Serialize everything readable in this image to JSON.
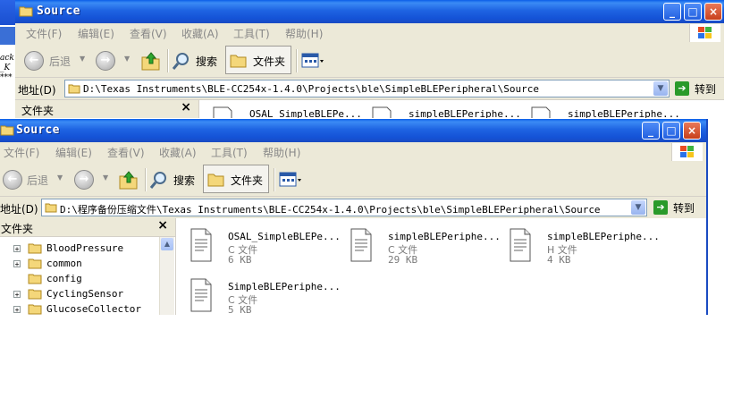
{
  "edge_fragment": {
    "line1": "ack",
    "line2": "_K",
    "line3": "***"
  },
  "back_window": {
    "title": "Source",
    "menu": [
      "文件(F)",
      "编辑(E)",
      "查看(V)",
      "收藏(A)",
      "工具(T)",
      "帮助(H)"
    ],
    "toolbar": {
      "back_label": "后退",
      "search_label": "搜索",
      "folders_label": "文件夹"
    },
    "address": {
      "label": "地址(D)",
      "path": "D:\\Texas Instruments\\BLE-CC254x-1.4.0\\Projects\\ble\\SimpleBLEPeripheral\\Source",
      "go_label": "转到"
    },
    "sidebar_title": "文件夹",
    "files": [
      "OSAL_SimpleBLEPe...",
      "simpleBLEPeriphe...",
      "simpleBLEPeriphe..."
    ]
  },
  "front_window": {
    "title": "Source",
    "menu": [
      "文件(F)",
      "编辑(E)",
      "查看(V)",
      "收藏(A)",
      "工具(T)",
      "帮助(H)"
    ],
    "toolbar": {
      "back_label": "后退",
      "search_label": "搜索",
      "folders_label": "文件夹"
    },
    "address": {
      "label": "地址(D)",
      "path": "D:\\程序备份压缩文件\\Texas Instruments\\BLE-CC254x-1.4.0\\Projects\\ble\\SimpleBLEPeripheral\\Source",
      "go_label": "转到"
    },
    "sidebar": {
      "title": "文件夹",
      "close": "×",
      "items": [
        {
          "label": "BloodPressure",
          "expander": "+"
        },
        {
          "label": "common",
          "expander": "+"
        },
        {
          "label": "config",
          "expander": ""
        },
        {
          "label": "CyclingSensor",
          "expander": "+"
        },
        {
          "label": "GlucoseCollector",
          "expander": "+"
        }
      ]
    },
    "files": [
      {
        "name": "OSAL_SimpleBLEPe...",
        "type": "C 文件",
        "size": "6 KB"
      },
      {
        "name": "simpleBLEPeriphe...",
        "type": "C 文件",
        "size": "29 KB"
      },
      {
        "name": "simpleBLEPeriphe...",
        "type": "H 文件",
        "size": "4 KB"
      },
      {
        "name": "SimpleBLEPeriphe...",
        "type": "C 文件",
        "size": "5 KB"
      }
    ]
  }
}
